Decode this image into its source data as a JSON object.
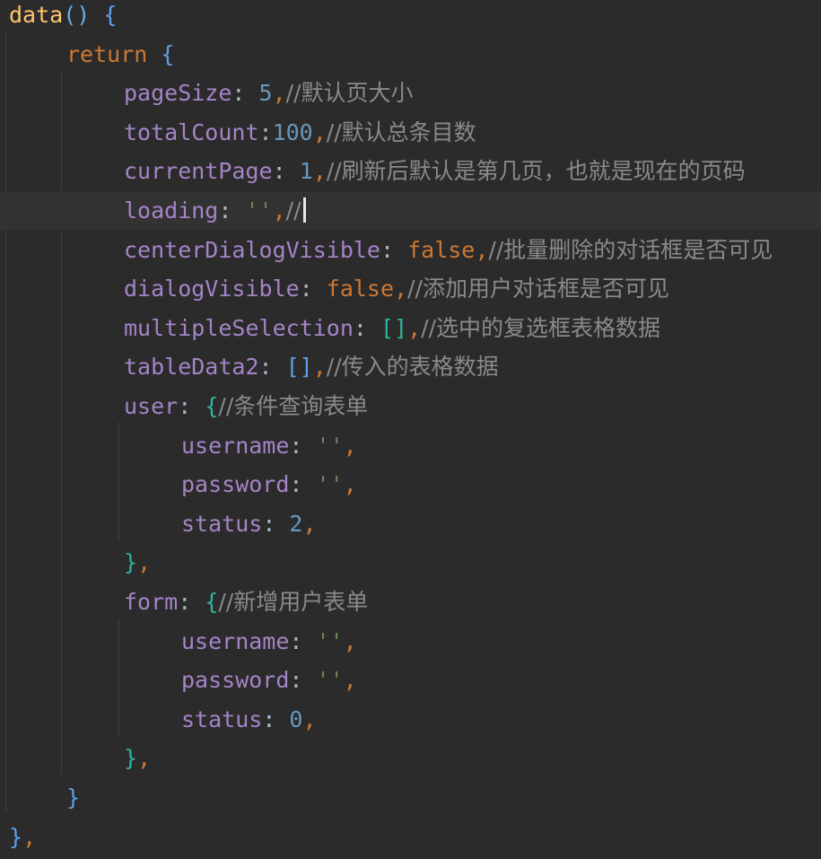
{
  "editor": {
    "lines": [
      {
        "tokens": [
          {
            "c": "fn",
            "t": "data"
          },
          {
            "c": "paren",
            "t": "()"
          },
          {
            "c": "punc",
            "t": " "
          },
          {
            "c": "brace",
            "t": "{"
          }
        ]
      },
      {
        "tokens": [
          {
            "c": "kw",
            "t": "return"
          },
          {
            "c": "punc",
            "t": " "
          },
          {
            "c": "brace",
            "t": "{"
          }
        ]
      },
      {
        "tokens": [
          {
            "c": "prop",
            "t": "pageSize"
          },
          {
            "c": "punc",
            "t": ": "
          },
          {
            "c": "num",
            "t": "5"
          },
          {
            "c": "comma",
            "t": ","
          },
          {
            "c": "cmt",
            "t": "//默认页大小"
          }
        ]
      },
      {
        "tokens": [
          {
            "c": "prop",
            "t": "totalCount"
          },
          {
            "c": "punc",
            "t": ":"
          },
          {
            "c": "num",
            "t": "100"
          },
          {
            "c": "comma",
            "t": ","
          },
          {
            "c": "cmt",
            "t": "//默认总条目数"
          }
        ]
      },
      {
        "tokens": [
          {
            "c": "prop",
            "t": "currentPage"
          },
          {
            "c": "punc",
            "t": ": "
          },
          {
            "c": "num",
            "t": "1"
          },
          {
            "c": "comma",
            "t": ","
          },
          {
            "c": "cmt",
            "t": "//刷新后默认是第几页，也就是现在的页码"
          }
        ]
      },
      {
        "tokens": [
          {
            "c": "prop",
            "t": "loading"
          },
          {
            "c": "punc",
            "t": ": "
          },
          {
            "c": "str",
            "t": "''"
          },
          {
            "c": "comma",
            "t": ","
          },
          {
            "c": "cmt",
            "t": "//"
          }
        ],
        "current": true
      },
      {
        "tokens": [
          {
            "c": "prop",
            "t": "centerDialogVisible"
          },
          {
            "c": "punc",
            "t": ": "
          },
          {
            "c": "bool",
            "t": "false"
          },
          {
            "c": "comma",
            "t": ","
          },
          {
            "c": "cmt",
            "t": "//批量删除的对话框是否可见"
          }
        ]
      },
      {
        "tokens": [
          {
            "c": "prop",
            "t": "dialogVisible"
          },
          {
            "c": "punc",
            "t": ": "
          },
          {
            "c": "bool",
            "t": "false"
          },
          {
            "c": "comma",
            "t": ","
          },
          {
            "c": "cmt",
            "t": "//添加用户对话框是否可见"
          }
        ]
      },
      {
        "tokens": [
          {
            "c": "prop",
            "t": "multipleSelection"
          },
          {
            "c": "punc",
            "t": ": "
          },
          {
            "c": "brace2",
            "t": "[]"
          },
          {
            "c": "comma",
            "t": ","
          },
          {
            "c": "cmt",
            "t": "//选中的复选框表格数据"
          }
        ]
      },
      {
        "tokens": [
          {
            "c": "prop",
            "t": "tableData2"
          },
          {
            "c": "punc",
            "t": ": "
          },
          {
            "c": "brace",
            "t": "[]"
          },
          {
            "c": "comma",
            "t": ","
          },
          {
            "c": "cmt",
            "t": "//传入的表格数据"
          }
        ]
      },
      {
        "tokens": [
          {
            "c": "prop",
            "t": "user"
          },
          {
            "c": "punc",
            "t": ": "
          },
          {
            "c": "brace2",
            "t": "{"
          },
          {
            "c": "cmt",
            "t": "//条件查询表单"
          }
        ]
      },
      {
        "tokens": [
          {
            "c": "prop",
            "t": "username"
          },
          {
            "c": "punc",
            "t": ": "
          },
          {
            "c": "str",
            "t": "''"
          },
          {
            "c": "comma",
            "t": ","
          }
        ]
      },
      {
        "tokens": [
          {
            "c": "prop",
            "t": "password"
          },
          {
            "c": "punc",
            "t": ": "
          },
          {
            "c": "str",
            "t": "''"
          },
          {
            "c": "comma",
            "t": ","
          }
        ]
      },
      {
        "tokens": [
          {
            "c": "prop",
            "t": "status"
          },
          {
            "c": "punc",
            "t": ": "
          },
          {
            "c": "num",
            "t": "2"
          },
          {
            "c": "comma",
            "t": ","
          }
        ]
      },
      {
        "tokens": [
          {
            "c": "brace2",
            "t": "}"
          },
          {
            "c": "comma",
            "t": ","
          }
        ]
      },
      {
        "tokens": [
          {
            "c": "prop",
            "t": "form"
          },
          {
            "c": "punc",
            "t": ": "
          },
          {
            "c": "brace2",
            "t": "{"
          },
          {
            "c": "cmt",
            "t": "//新增用户表单"
          }
        ]
      },
      {
        "tokens": [
          {
            "c": "prop",
            "t": "username"
          },
          {
            "c": "punc",
            "t": ": "
          },
          {
            "c": "str",
            "t": "''"
          },
          {
            "c": "comma",
            "t": ","
          }
        ]
      },
      {
        "tokens": [
          {
            "c": "prop",
            "t": "password"
          },
          {
            "c": "punc",
            "t": ": "
          },
          {
            "c": "str",
            "t": "''"
          },
          {
            "c": "comma",
            "t": ","
          }
        ]
      },
      {
        "tokens": [
          {
            "c": "prop",
            "t": "status"
          },
          {
            "c": "punc",
            "t": ": "
          },
          {
            "c": "num",
            "t": "0"
          },
          {
            "c": "comma",
            "t": ","
          }
        ]
      },
      {
        "tokens": [
          {
            "c": "brace2",
            "t": "}"
          },
          {
            "c": "comma",
            "t": ","
          }
        ]
      },
      {
        "tokens": [
          {
            "c": "brace",
            "t": "}"
          }
        ]
      },
      {
        "tokens": [
          {
            "c": "brace",
            "t": "}"
          },
          {
            "c": "comma",
            "t": ","
          }
        ]
      }
    ]
  }
}
